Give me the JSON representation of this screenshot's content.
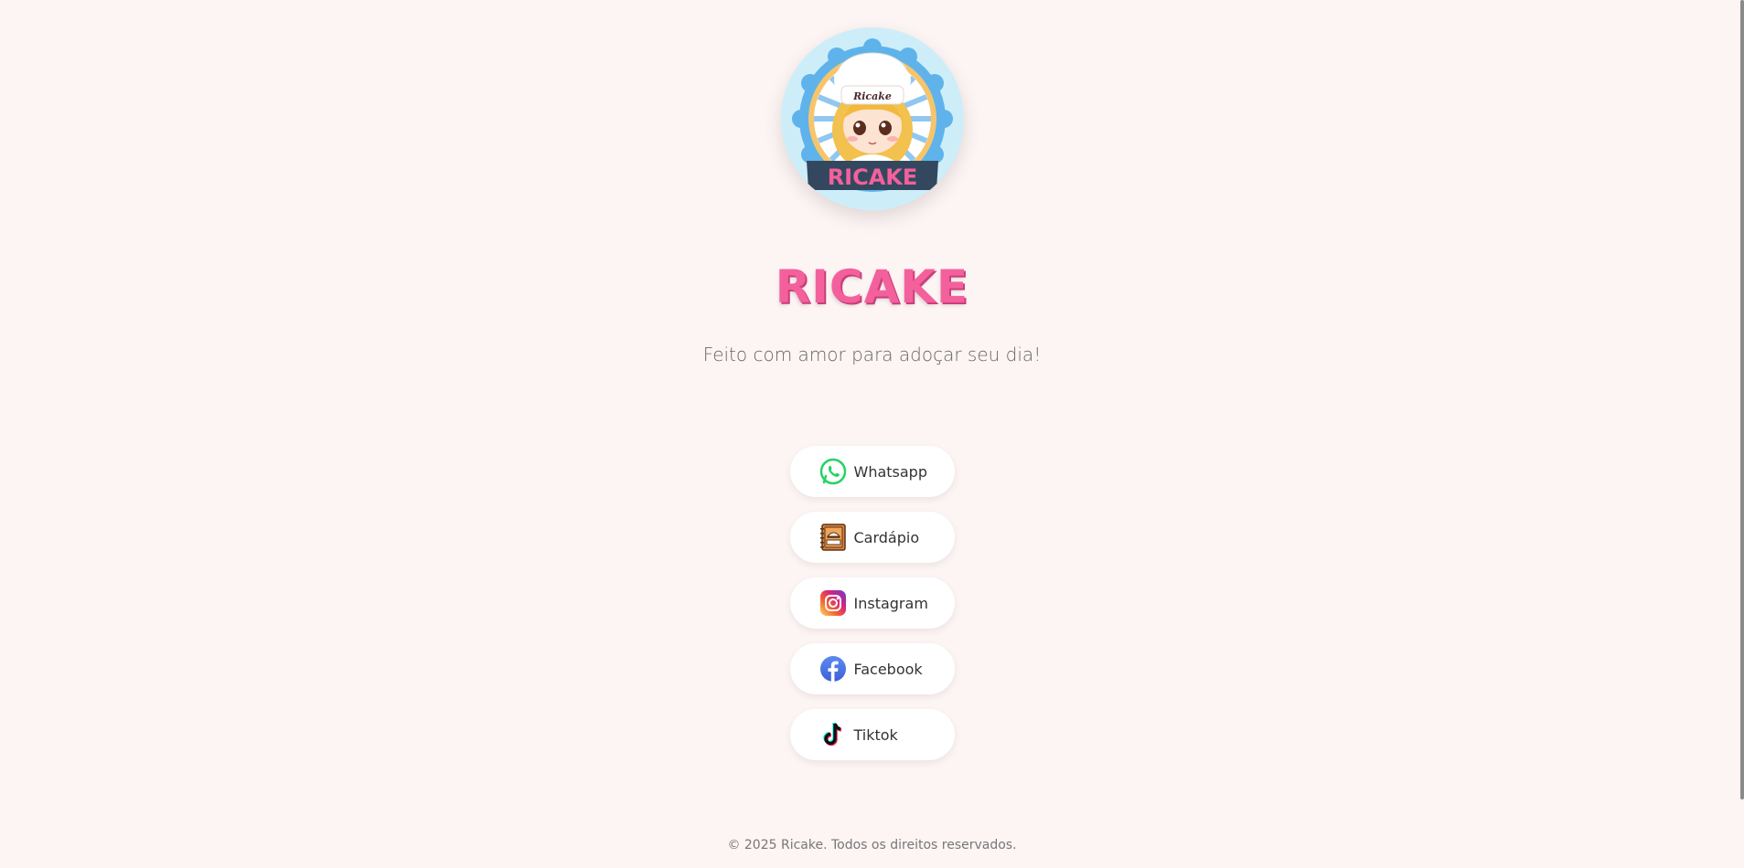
{
  "brand": {
    "logo_text": "RICAKE",
    "logo_hat_text": "Ricake",
    "title": "RICAKE",
    "subtitle": "Feito com amor para adoçar seu dia!"
  },
  "links": [
    {
      "id": "whatsapp",
      "label": "Whatsapp",
      "icon": "whatsapp-icon"
    },
    {
      "id": "cardapio",
      "label": "Cardápio",
      "icon": "menu-book-icon"
    },
    {
      "id": "instagram",
      "label": "Instagram",
      "icon": "instagram-icon"
    },
    {
      "id": "facebook",
      "label": "Facebook",
      "icon": "facebook-icon"
    },
    {
      "id": "tiktok",
      "label": "Tiktok",
      "icon": "tiktok-icon"
    }
  ],
  "footer": {
    "text": "© 2025 Ricake. Todos os direitos reservados."
  },
  "colors": {
    "background": "#fdf4f4",
    "brand_pink": "#f4609c",
    "whatsapp": "#25d366",
    "facebook": "#4a78e8"
  }
}
